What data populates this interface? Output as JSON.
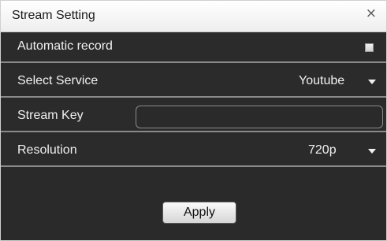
{
  "dialog": {
    "title": "Stream Setting",
    "close_symbol": "×"
  },
  "rows": {
    "auto_record": {
      "label": "Automatic record",
      "checked": false
    },
    "service": {
      "label": "Select Service",
      "value": "Youtube"
    },
    "stream_key": {
      "label": "Stream Key",
      "value": "",
      "placeholder": ""
    },
    "resolution": {
      "label": "Resolution",
      "value": "720p"
    }
  },
  "actions": {
    "apply_label": "Apply"
  },
  "icons": {
    "close": "close-icon",
    "dropdown": "chevron-down-icon",
    "checkbox": "checkbox-icon"
  },
  "colors": {
    "panel_background": "#2b2b2b",
    "row_divider": "#8a8a8a",
    "text": "#f0f0f0",
    "titlebar": "#f4f4f4"
  }
}
